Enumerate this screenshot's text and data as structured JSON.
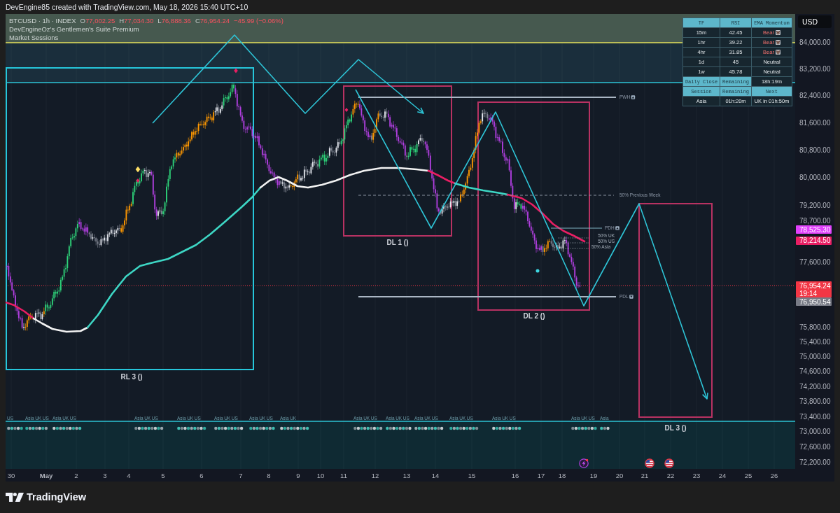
{
  "caption": "DevEngine85 created with TradingView.com, May 18, 2026 15:40 UTC+10",
  "legend": {
    "symbol": "BTCUSD · 1h · INDEX",
    "falling": true,
    "ohlc": [
      {
        "label": "O",
        "value": "77,002.25"
      },
      {
        "label": "H",
        "value": "77,034.30"
      },
      {
        "label": "L",
        "value": "76,888.36"
      },
      {
        "label": "C",
        "value": "76,954.24"
      }
    ],
    "change": "−45.99 (−0.06%)",
    "indicators": [
      "DevEngineOz's Gentlemen's Suite Premium",
      "Market Sessions"
    ]
  },
  "info_table": {
    "columns": [
      "TF",
      "RSI",
      "EMA Momentum"
    ],
    "rows": [
      {
        "tf": "15m",
        "rsi": "42.45",
        "momentum": "Bear",
        "kind": "bear"
      },
      {
        "tf": "1hr",
        "rsi": "39.22",
        "momentum": "Bear",
        "kind": "bear"
      },
      {
        "tf": "4hr",
        "rsi": "31.85",
        "momentum": "Bear",
        "kind": "bear"
      },
      {
        "tf": "1d",
        "rsi": "45",
        "momentum": "Neutral",
        "kind": "neutral"
      },
      {
        "tf": "1w",
        "rsi": "45.78",
        "momentum": "Neutral",
        "kind": "neutral"
      }
    ],
    "daily_close": [
      "Daily Close",
      "Remaining",
      "18h:19m"
    ],
    "session_columns": [
      "Session",
      "Remaining",
      "Next"
    ],
    "session_row": [
      "Asia",
      "01h:20m",
      "UK in 01h:50m"
    ]
  },
  "price_axis": {
    "currency": "USD",
    "ticks": [
      "84,000.00",
      "83,200.00",
      "82,400.00",
      "81,600.00",
      "80,800.00",
      "80,000.00",
      "79,200.00",
      "78,700.00",
      "77,600.00",
      "75,800.00",
      "75,400.00",
      "75,000.00",
      "74,600.00",
      "74,200.00",
      "73,800.00",
      "73,400.00",
      "73,000.00",
      "72,600.00",
      "72,200.00"
    ],
    "tags": [
      {
        "lines": [
          "78,525.30"
        ],
        "color": "#e040fb"
      },
      {
        "lines": [
          "78,214.50"
        ],
        "color": "#e91e63"
      },
      {
        "lines": [
          "76,954.24",
          "19:14"
        ],
        "color": "#f23645"
      },
      {
        "lines": [
          "76,950.54"
        ],
        "color": "#787b86"
      }
    ]
  },
  "chart": {
    "zones": [
      {
        "label": "RL 3 ()",
        "color": "#26c6da"
      },
      {
        "label": "DL 1 ()",
        "color": "#b83262"
      },
      {
        "label": "DL 2 ()",
        "color": "#b83262"
      },
      {
        "label": "DL 3 ()",
        "color": "#b83262"
      }
    ],
    "levels": [
      {
        "label": "PWH",
        "kind": "high"
      },
      {
        "label": "50% Previous Week",
        "kind": "mid"
      },
      {
        "label": "PDH",
        "kind": "high"
      },
      {
        "label": "PDL",
        "kind": "low"
      }
    ],
    "session_mids": [
      "50% UK",
      "50% US",
      "50% Asia"
    ],
    "session_labels": [
      [
        "US"
      ],
      [
        "Asia",
        "UK",
        "US"
      ],
      [
        "Asia",
        "UK",
        "US"
      ],
      [
        "Asia",
        "UK",
        "US"
      ],
      [
        "Asia",
        "UK",
        "US"
      ],
      [
        "Asia",
        "UK",
        "US"
      ],
      [
        "Asia",
        "UK",
        "US"
      ],
      [
        "Asia",
        "UK"
      ],
      [
        "Asia",
        "UK",
        "US"
      ],
      [
        "Asia",
        "UK",
        "US"
      ],
      [
        "Asia",
        "UK",
        "US"
      ],
      [
        "Asia",
        "UK",
        "US"
      ],
      [
        "Asia",
        "UK",
        "US"
      ],
      [
        "Asia",
        "UK",
        "US"
      ],
      [
        "Asia"
      ]
    ]
  },
  "time_axis": [
    {
      "text": "30",
      "kind": "day"
    },
    {
      "text": "May",
      "kind": "month"
    },
    {
      "text": "2",
      "kind": "day"
    },
    {
      "text": "3",
      "kind": "day"
    },
    {
      "text": "4",
      "kind": "day"
    },
    {
      "text": "5",
      "kind": "day"
    },
    {
      "text": "6",
      "kind": "day"
    },
    {
      "text": "7",
      "kind": "day"
    },
    {
      "text": "8",
      "kind": "day"
    },
    {
      "text": "9",
      "kind": "day"
    },
    {
      "text": "10",
      "kind": "day"
    },
    {
      "text": "11",
      "kind": "day"
    },
    {
      "text": "12",
      "kind": "day"
    },
    {
      "text": "13",
      "kind": "day"
    },
    {
      "text": "14",
      "kind": "day"
    },
    {
      "text": "15",
      "kind": "day"
    },
    {
      "text": "16",
      "kind": "day"
    },
    {
      "text": "17",
      "kind": "day"
    },
    {
      "text": "18",
      "kind": "day"
    },
    {
      "text": "19",
      "kind": "day"
    },
    {
      "text": "20",
      "kind": "day"
    },
    {
      "text": "21",
      "kind": "day"
    },
    {
      "text": "22",
      "kind": "day"
    },
    {
      "text": "23",
      "kind": "day"
    },
    {
      "text": "24",
      "kind": "day"
    },
    {
      "text": "25",
      "kind": "day"
    },
    {
      "text": "26",
      "kind": "day"
    }
  ],
  "branding": "TradingView"
}
